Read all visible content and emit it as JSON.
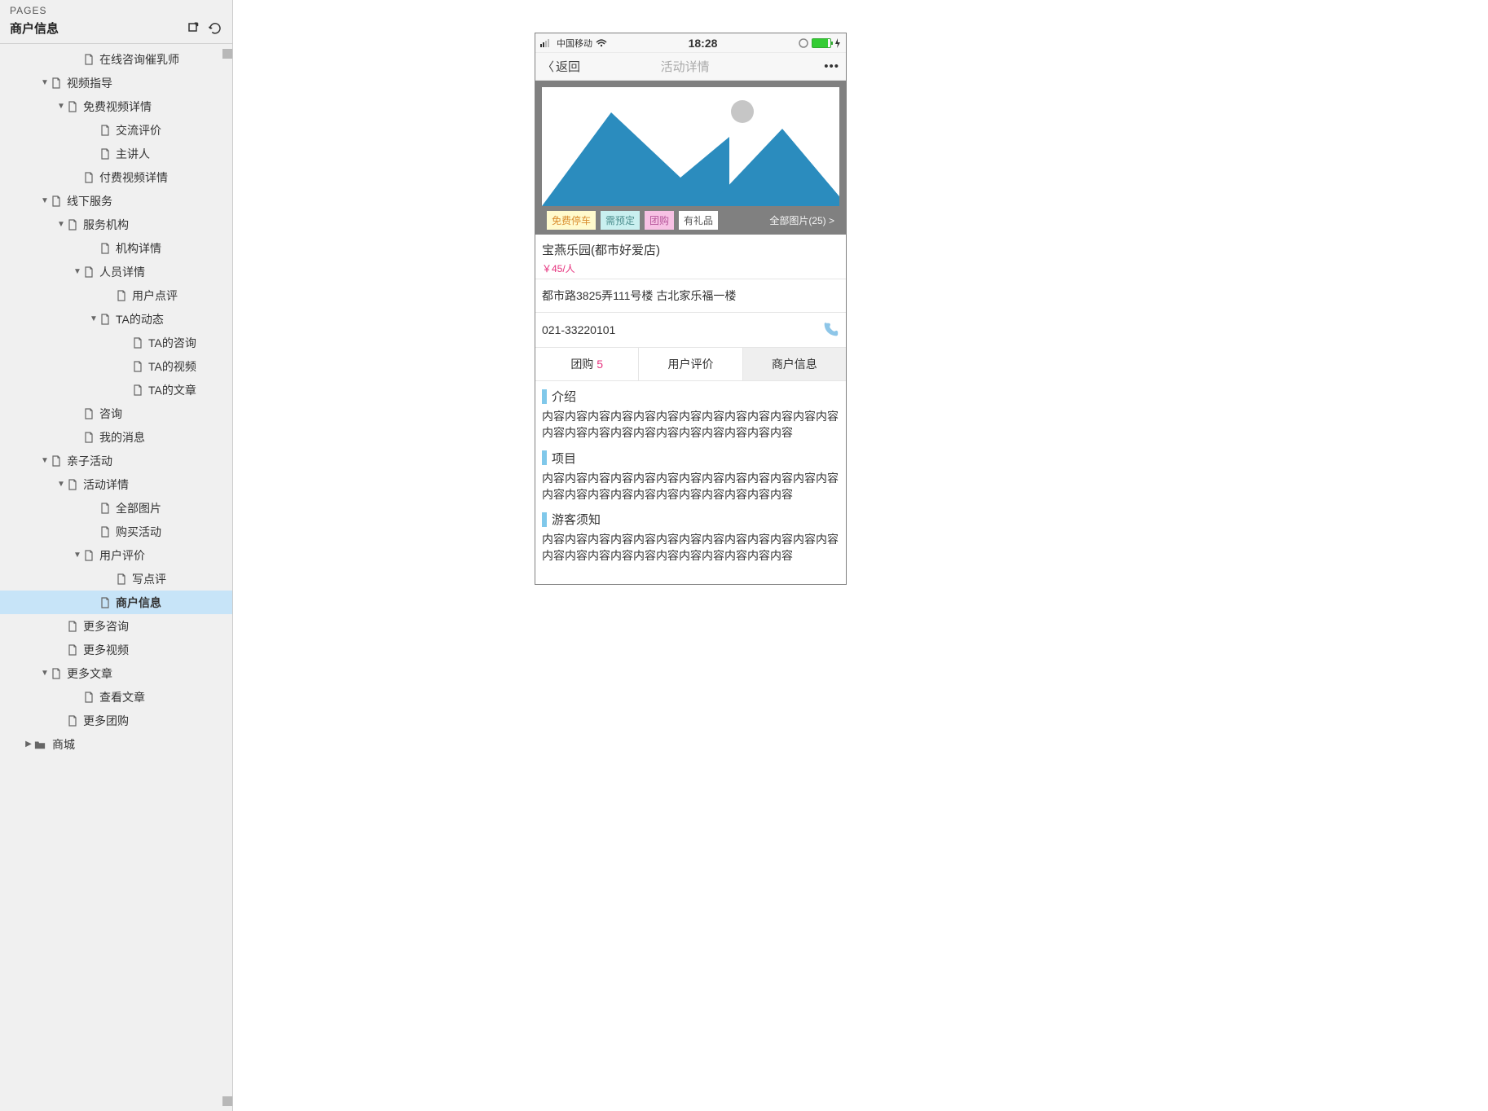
{
  "sidebar": {
    "label": "PAGES",
    "title": "商户信息",
    "tree": [
      {
        "indent": 4,
        "icon": "page",
        "caret": "none",
        "label": "在线咨询催乳师",
        "selected": false
      },
      {
        "indent": 2,
        "icon": "page",
        "caret": "down",
        "label": "视频指导",
        "selected": false
      },
      {
        "indent": 3,
        "icon": "page",
        "caret": "down",
        "label": "免费视频详情",
        "selected": false
      },
      {
        "indent": 5,
        "icon": "page",
        "caret": "none",
        "label": "交流评价",
        "selected": false
      },
      {
        "indent": 5,
        "icon": "page",
        "caret": "none",
        "label": "主讲人",
        "selected": false
      },
      {
        "indent": 4,
        "icon": "page",
        "caret": "none",
        "label": "付费视频详情",
        "selected": false
      },
      {
        "indent": 2,
        "icon": "page",
        "caret": "down",
        "label": "线下服务",
        "selected": false
      },
      {
        "indent": 3,
        "icon": "page",
        "caret": "down",
        "label": "服务机构",
        "selected": false
      },
      {
        "indent": 5,
        "icon": "page",
        "caret": "none",
        "label": "机构详情",
        "selected": false
      },
      {
        "indent": 4,
        "icon": "page",
        "caret": "down",
        "label": "人员详情",
        "selected": false
      },
      {
        "indent": 6,
        "icon": "page",
        "caret": "none",
        "label": "用户点评",
        "selected": false
      },
      {
        "indent": 5,
        "icon": "page",
        "caret": "down",
        "label": "TA的动态",
        "selected": false
      },
      {
        "indent": 7,
        "icon": "page",
        "caret": "none",
        "label": "TA的咨询",
        "selected": false
      },
      {
        "indent": 7,
        "icon": "page",
        "caret": "none",
        "label": "TA的视频",
        "selected": false
      },
      {
        "indent": 7,
        "icon": "page",
        "caret": "none",
        "label": "TA的文章",
        "selected": false
      },
      {
        "indent": 4,
        "icon": "page",
        "caret": "none",
        "label": "咨询",
        "selected": false
      },
      {
        "indent": 4,
        "icon": "page",
        "caret": "none",
        "label": "我的消息",
        "selected": false
      },
      {
        "indent": 2,
        "icon": "page",
        "caret": "down",
        "label": "亲子活动",
        "selected": false
      },
      {
        "indent": 3,
        "icon": "page",
        "caret": "down",
        "label": "活动详情",
        "selected": false
      },
      {
        "indent": 5,
        "icon": "page",
        "caret": "none",
        "label": "全部图片",
        "selected": false
      },
      {
        "indent": 5,
        "icon": "page",
        "caret": "none",
        "label": "购买活动",
        "selected": false
      },
      {
        "indent": 4,
        "icon": "page",
        "caret": "down",
        "label": "用户评价",
        "selected": false
      },
      {
        "indent": 6,
        "icon": "page",
        "caret": "none",
        "label": "写点评",
        "selected": false
      },
      {
        "indent": 5,
        "icon": "page",
        "caret": "none",
        "label": "商户信息",
        "selected": true
      },
      {
        "indent": 3,
        "icon": "page",
        "caret": "none",
        "label": "更多咨询",
        "selected": false
      },
      {
        "indent": 3,
        "icon": "page",
        "caret": "none",
        "label": "更多视频",
        "selected": false
      },
      {
        "indent": 2,
        "icon": "page",
        "caret": "down",
        "label": "更多文章",
        "selected": false
      },
      {
        "indent": 4,
        "icon": "page",
        "caret": "none",
        "label": "查看文章",
        "selected": false
      },
      {
        "indent": 3,
        "icon": "page",
        "caret": "none",
        "label": "更多团购",
        "selected": false
      },
      {
        "indent": 1,
        "icon": "folder",
        "caret": "right",
        "label": "商城",
        "selected": false
      }
    ]
  },
  "phone": {
    "status": {
      "carrier": "中国移动",
      "time": "18:28"
    },
    "nav": {
      "back": "返回",
      "title": "活动详情",
      "more": "•••"
    },
    "tags": [
      {
        "text": "免费停车",
        "cls": "yellow"
      },
      {
        "text": "需预定",
        "cls": "cyan"
      },
      {
        "text": "团购",
        "cls": "pink"
      },
      {
        "text": "有礼品",
        "cls": ""
      }
    ],
    "allPhotos": "全部图片(25) >",
    "shop": {
      "name": "宝燕乐园(都市好爱店)",
      "price": "￥45/人"
    },
    "address": "都市路3825弄111号楼 古北家乐福一楼",
    "phoneNum": "021-33220101",
    "tabs": [
      {
        "label": "团购",
        "count": "5",
        "active": false
      },
      {
        "label": "用户评价",
        "count": "",
        "active": false
      },
      {
        "label": "商户信息",
        "count": "",
        "active": true
      }
    ],
    "sections": [
      {
        "title": "介绍",
        "body": "内容内容内容内容内容内容内容内容内容内容内容内容内容内容内容内容内容内容内容内容内容内容内容内容"
      },
      {
        "title": "项目",
        "body": "内容内容内容内容内容内容内容内容内容内容内容内容内容内容内容内容内容内容内容内容内容内容内容内容"
      },
      {
        "title": "游客须知",
        "body": "内容内容内容内容内容内容内容内容内容内容内容内容内容内容内容内容内容内容内容内容内容内容内容内容"
      }
    ]
  }
}
